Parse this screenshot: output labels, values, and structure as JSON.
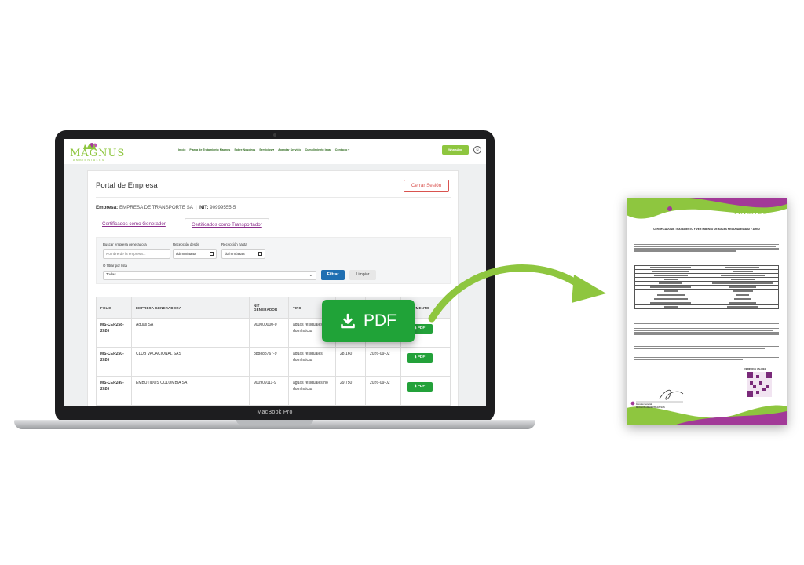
{
  "brand": {
    "logo_text": "MAGNUS",
    "logo_sub": "AMBIENTALES",
    "accent_color": "#8ec63f",
    "primary_blue": "#1f6fb2",
    "download_green": "#20a338"
  },
  "nav": {
    "items": [
      "Inicio",
      "Planta de Tratamiento Magnus",
      "Sobre Nosotros",
      "Servicios ▾",
      "Agendar Servicio",
      "Cumplimiento legal",
      "Contacto ▾"
    ],
    "whatsapp_label": "WhatsApp",
    "user_icon": "user-icon"
  },
  "portal": {
    "title": "Portal de Empresa",
    "logout_label": "Cerrar Sesión",
    "company_label": "Empresa:",
    "company_name": "EMPRESA DE TRANSPORTE SA",
    "nit_label": "NIT:",
    "nit_value": "90999555-5",
    "tabs": [
      {
        "label": "Certificados como Generador",
        "active": false
      },
      {
        "label": "Certificados como Transportador",
        "active": true
      }
    ]
  },
  "filters": {
    "search_label": "Buscar empresa generadora",
    "search_placeholder": "Nombre de la empresa...",
    "from_label": "Recepción desde",
    "from_value": "dd/mm/aaaa",
    "to_label": "Recepción hasta",
    "to_value": "dd/mm/aaaa",
    "list_label": "O filtrar por lista",
    "list_selected": "Todas",
    "filter_button": "Filtrar",
    "clear_button": "Limpiar"
  },
  "table": {
    "headers": [
      "FOLIO",
      "EMPRESA GENERADORA",
      "NIT GENERADOR",
      "TIPO",
      "",
      "",
      "DOCUMENTO"
    ],
    "pdf_label": "PDF",
    "rows": [
      {
        "folio": "MS-CER258-2026",
        "empresa": "Aguas SA",
        "nit": "900000000-0",
        "tipo": "aguas residuales domésticas",
        "cantidad": "",
        "fecha": ""
      },
      {
        "folio": "MS-CER250-2026",
        "empresa": "CLUB VACACIONAL SAS",
        "nit": "888888767-9",
        "tipo": "aguas residuales domésticas",
        "cantidad": "28.160",
        "fecha": "2026-09-02"
      },
      {
        "folio": "MS-CER249-2026",
        "empresa": "EMBUTIDOS COLOMBIA SA",
        "nit": "900909111-9",
        "tipo": "aguas residuales no domésticas",
        "cantidad": "29.750",
        "fecha": "2026-09-02"
      }
    ]
  },
  "overlay": {
    "pdf_label": "PDF",
    "icon": "download-icon"
  },
  "laptop": {
    "label": "MacBook Pro"
  },
  "document": {
    "logo_text": "MAGNUS",
    "title": "CERTIFICADO DE TRATAMIENTO Y VERTIMIENTO DE AGUAS RESIDUALES ARD Y ARND",
    "qr_title": "VERIFIQUE VALIDEZ",
    "signer_title": "Gerente General",
    "signer_company": "MAGNUS AMBIENTALES SAS"
  }
}
